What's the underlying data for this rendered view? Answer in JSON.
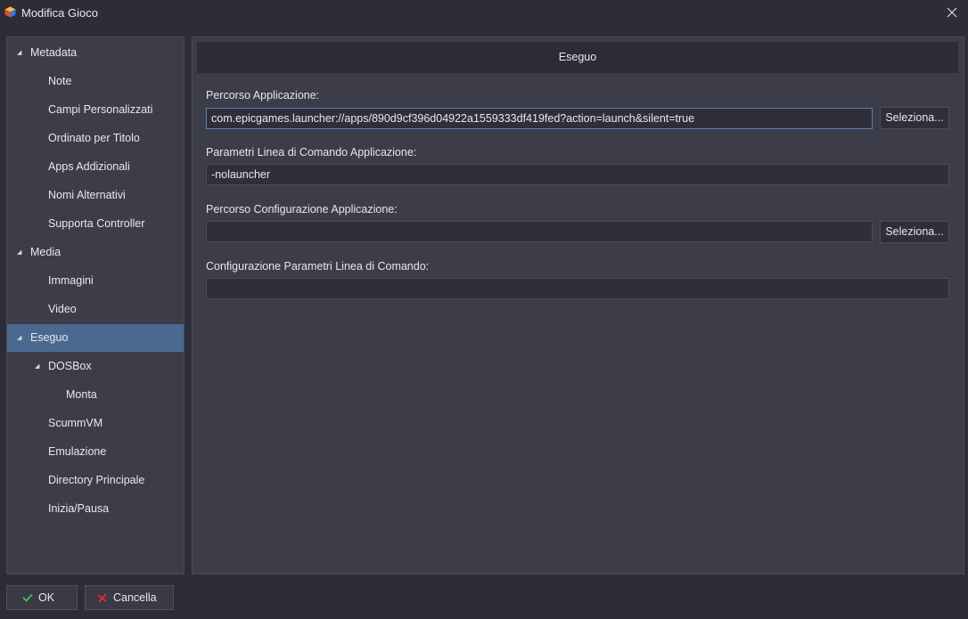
{
  "window": {
    "title": "Modifica Gioco",
    "icon": "app-cube-icon",
    "close_icon": "close-icon"
  },
  "sidebar": {
    "items": [
      {
        "label": "Metadata",
        "level": 0,
        "expanded": true,
        "selected": false
      },
      {
        "label": "Note",
        "level": 1,
        "expanded": false,
        "selected": false
      },
      {
        "label": "Campi Personalizzati",
        "level": 1,
        "expanded": false,
        "selected": false
      },
      {
        "label": "Ordinato per Titolo",
        "level": 1,
        "expanded": false,
        "selected": false
      },
      {
        "label": "Apps Addizionali",
        "level": 1,
        "expanded": false,
        "selected": false
      },
      {
        "label": "Nomi Alternativi",
        "level": 1,
        "expanded": false,
        "selected": false
      },
      {
        "label": "Supporta Controller",
        "level": 1,
        "expanded": false,
        "selected": false
      },
      {
        "label": "Media",
        "level": 0,
        "expanded": true,
        "selected": false
      },
      {
        "label": "Immagini",
        "level": 1,
        "expanded": false,
        "selected": false
      },
      {
        "label": "Video",
        "level": 1,
        "expanded": false,
        "selected": false
      },
      {
        "label": "Eseguo",
        "level": 0,
        "expanded": true,
        "selected": true
      },
      {
        "label": "DOSBox",
        "level": 1,
        "expanded": true,
        "selected": false
      },
      {
        "label": "Monta",
        "level": 2,
        "expanded": false,
        "selected": false
      },
      {
        "label": "ScummVM",
        "level": 1,
        "expanded": false,
        "selected": false
      },
      {
        "label": "Emulazione",
        "level": 1,
        "expanded": false,
        "selected": false
      },
      {
        "label": "Directory Principale",
        "level": 1,
        "expanded": false,
        "selected": false
      },
      {
        "label": "Inizia/Pausa",
        "level": 1,
        "expanded": false,
        "selected": false
      }
    ]
  },
  "main": {
    "header": "Eseguo",
    "fields": {
      "app_path": {
        "label": "Percorso Applicazione:",
        "value": "com.epicgames.launcher://apps/890d9cf396d04922a1559333df419fed?action=launch&silent=true",
        "browse_label": "Seleziona..."
      },
      "app_args": {
        "label": "Parametri Linea di Comando Applicazione:",
        "value": "-nolauncher"
      },
      "config_path": {
        "label": "Percorso Configurazione Applicazione:",
        "value": "",
        "browse_label": "Seleziona..."
      },
      "config_args": {
        "label": "Configurazione Parametri Linea di Comando:",
        "value": ""
      }
    }
  },
  "footer": {
    "ok_label": "OK",
    "cancel_label": "Cancella"
  },
  "colors": {
    "background": "#2c2d36",
    "panel": "#3c3d49",
    "selected": "#4a6991",
    "ok_check": "#3cc45a",
    "cancel_x": "#d8303a"
  }
}
